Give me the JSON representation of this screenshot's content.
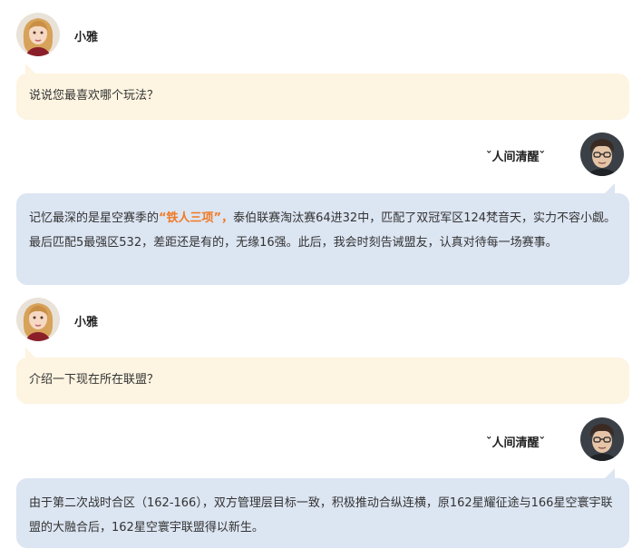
{
  "messages": [
    {
      "speaker": "小雅",
      "side": "left",
      "avatar": "girl-avatar",
      "text": "说说您最喜欢哪个玩法？"
    },
    {
      "speaker": "ˇ人间清醒ˇ",
      "side": "right",
      "avatar": "boy-avatar",
      "text_before": "记忆最深的是星空赛季的",
      "highlight": "“铁人三项”，",
      "text_after": "泰伯联赛淘汰赛64进32中，匹配了双冠军区124梵音天，实力不容小觑。最后匹配5最强区532，差距还是有的，无缘16强。此后，我会时刻告诫盟友，认真对待每一场赛事。"
    },
    {
      "speaker": "小雅",
      "side": "left",
      "avatar": "girl-avatar",
      "text": "介绍一下现在所在联盟？"
    },
    {
      "speaker": "ˇ人间清醒ˇ",
      "side": "right",
      "avatar": "boy-avatar",
      "text": "由于第二次战时合区（162-166），双方管理层目标一致，积极推动合纵连横，原162星耀征途与166星空寰宇联盟的大融合后，162星空寰宇联盟得以新生。"
    }
  ],
  "colors": {
    "left_bubble": "#fdf4e1",
    "right_bubble": "#dce5f2",
    "highlight": "#f07a24"
  }
}
